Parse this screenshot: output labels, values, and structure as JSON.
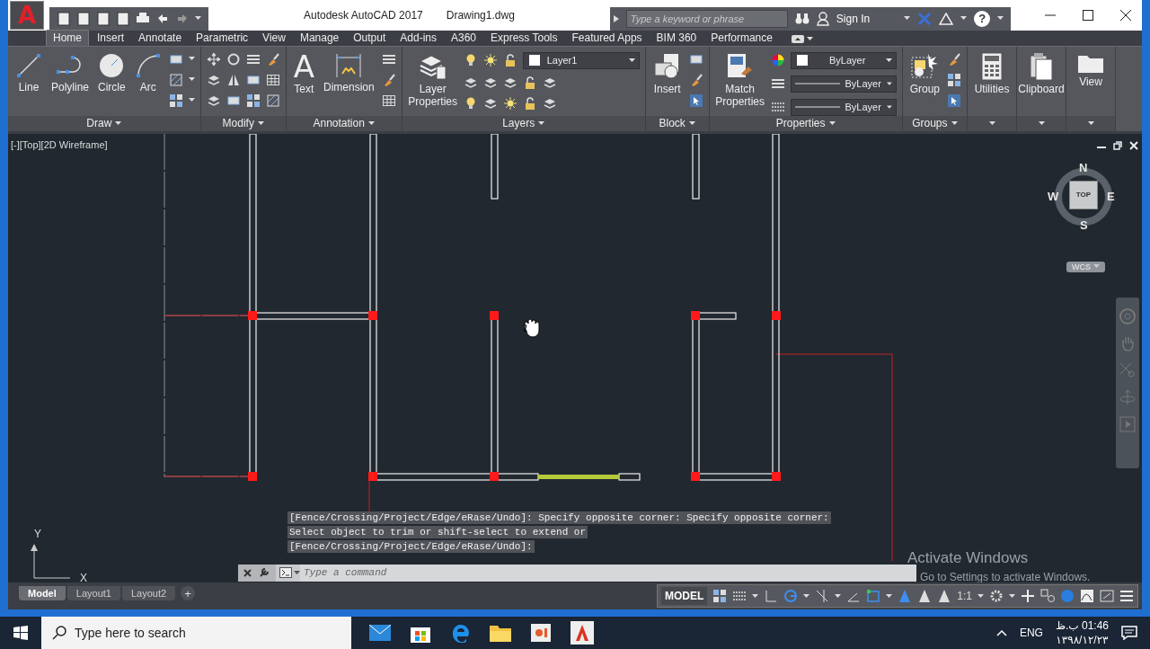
{
  "title_bar": {
    "logo": "A",
    "app_title": "Autodesk AutoCAD 2017",
    "file_name": "Drawing1.dwg",
    "search": {
      "placeholder": "Type a keyword or phrase"
    },
    "sign_in": "Sign In",
    "help": "?"
  },
  "ribbon_tabs": [
    {
      "label": "Home",
      "selected": true
    },
    {
      "label": "Insert",
      "selected": false
    },
    {
      "label": "Annotate",
      "selected": false
    },
    {
      "label": "Parametric",
      "selected": false
    },
    {
      "label": "View",
      "selected": false
    },
    {
      "label": "Manage",
      "selected": false
    },
    {
      "label": "Output",
      "selected": false
    },
    {
      "label": "Add-ins",
      "selected": false
    },
    {
      "label": "A360",
      "selected": false
    },
    {
      "label": "Express Tools",
      "selected": false
    },
    {
      "label": "Featured Apps",
      "selected": false
    },
    {
      "label": "BIM 360",
      "selected": false
    },
    {
      "label": "Performance",
      "selected": false
    }
  ],
  "ribbon_panels": [
    {
      "title": "Draw",
      "kind": "draw",
      "tools": [
        "Line",
        "Polyline",
        "Circle",
        "Arc"
      ]
    },
    {
      "title": "Modify",
      "kind": "modify"
    },
    {
      "title": "Annotation",
      "kind": "annotation",
      "glyph": "A",
      "tools": [
        "Text",
        "Dimension"
      ]
    },
    {
      "title": "Layers",
      "kind": "layers",
      "tools": [
        "Layer Properties"
      ],
      "layer": "Layer1"
    },
    {
      "title": "Block",
      "kind": "block",
      "tools": [
        "Insert"
      ]
    },
    {
      "title": "Properties",
      "kind": "properties",
      "tools": [
        "Match Properties"
      ],
      "values": [
        "ByLayer",
        "ByLayer",
        "ByLayer"
      ]
    },
    {
      "title": "Groups",
      "kind": "groups",
      "tools": [
        "Group"
      ]
    },
    {
      "kind": "single",
      "tools": [
        "Utilities"
      ]
    },
    {
      "kind": "single",
      "tools": [
        "Clipboard"
      ]
    },
    {
      "kind": "single",
      "tools": [
        "View"
      ]
    }
  ],
  "viewport": {
    "label": "[-][Top][2D Wireframe]",
    "compass": {
      "north": "N",
      "east": "E",
      "south": "S",
      "west": "W",
      "face": "TOP"
    },
    "ucs": "WCS",
    "y_label": "Y",
    "x_label": "X"
  },
  "command": {
    "history": [
      "[Fence/Crossing/Project/Edge/eRase/Undo]: Specify opposite corner: Specify opposite corner:",
      "Select object to trim or shift-select to extend or",
      "[Fence/Crossing/Project/Edge/eRase/Undo]:"
    ],
    "placeholder": "Type a command"
  },
  "activation": {
    "title": "Activate Windows",
    "message": "Go to Settings to activate Windows."
  },
  "layout_tabs": [
    {
      "label": "Model",
      "selected": true
    },
    {
      "label": "Layout1",
      "selected": false
    },
    {
      "label": "Layout2",
      "selected": false
    }
  ],
  "add_tab": "+",
  "status_bar": {
    "space": "MODEL",
    "scale": "1:1"
  },
  "taskbar": {
    "search": {
      "placeholder": "Type here to search"
    },
    "language": "ENG",
    "time": "01:46 ب.ظ",
    "date": "۱۳۹۸/۱۲/۲۳"
  }
}
